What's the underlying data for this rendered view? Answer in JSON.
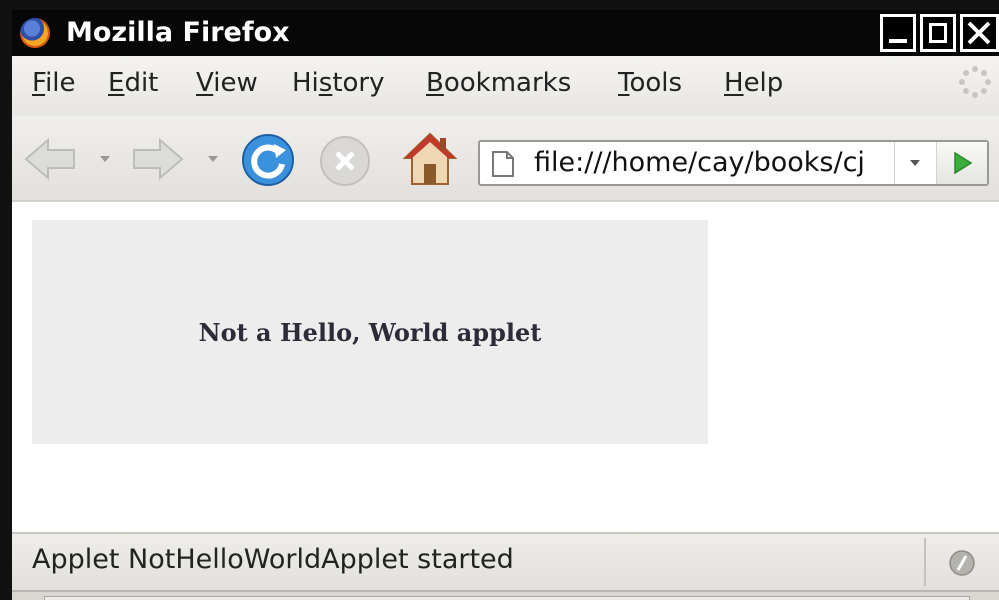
{
  "window": {
    "title": "Mozilla Firefox",
    "minimize_icon": "minimize-icon",
    "maximize_icon": "maximize-icon",
    "close_icon": "close-icon"
  },
  "menubar": {
    "items": [
      {
        "first": "F",
        "rest": "ile",
        "underline": "first"
      },
      {
        "first": "E",
        "rest": "dit",
        "underline": "first"
      },
      {
        "first": "V",
        "rest": "iew",
        "underline": "first"
      },
      {
        "pre": "Hi",
        "u": "s",
        "post": "tory"
      },
      {
        "first": "B",
        "rest": "ookmarks",
        "underline": "first"
      },
      {
        "first": "T",
        "rest": "ools",
        "underline": "first"
      },
      {
        "first": "H",
        "rest": "elp",
        "underline": "first"
      }
    ],
    "throbber_icon": "throbber-icon"
  },
  "toolbar": {
    "back_icon": "back-arrow-icon",
    "forward_icon": "forward-arrow-icon",
    "reload_icon": "reload-icon",
    "stop_icon": "stop-icon",
    "home_icon": "home-icon",
    "url": "file:///home/cay/books/cj",
    "go_icon": "go-arrow-icon"
  },
  "content": {
    "applet_text": "Not a Hello, World applet",
    "applet_background": "#ededed"
  },
  "statusbar": {
    "text": "Applet NotHelloWorldApplet started",
    "status_icon": "java-status-icon"
  },
  "colors": {
    "titlebar": "#070707",
    "chrome": "#ebe9e5",
    "go_arrow": "#3cae3c",
    "reload_blue": "#2f86d6"
  }
}
